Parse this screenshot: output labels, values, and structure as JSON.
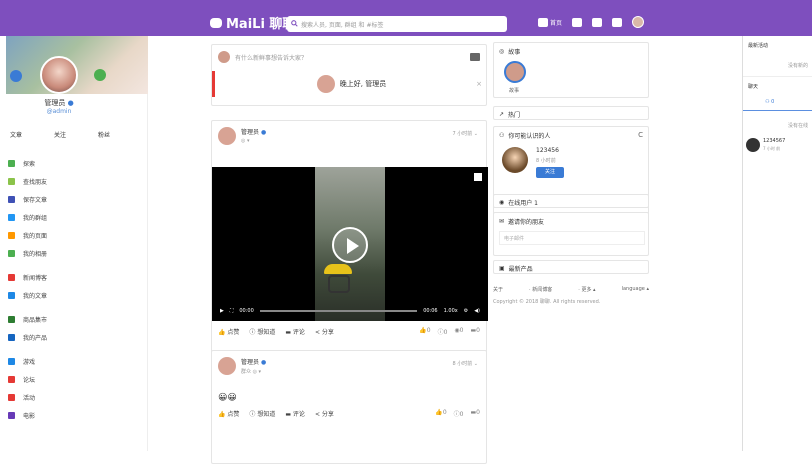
{
  "topbar": {
    "brand": "MaiLi 聊聊",
    "search_placeholder": "搜索人员, 页面, 群组 和 #标签",
    "home_label": "首页"
  },
  "profile": {
    "name": "管理员",
    "handle": "@admin",
    "stats": [
      "文章",
      "关注",
      "粉丝"
    ]
  },
  "menu": [
    {
      "label": "探索",
      "color": "#4caf50"
    },
    {
      "label": "查找朋友",
      "color": "#8bc34a"
    },
    {
      "label": "保存文章",
      "color": "#3f51b5"
    },
    {
      "label": "我的群组",
      "color": "#2196f3"
    },
    {
      "label": "我的页面",
      "color": "#ff9800"
    },
    {
      "label": "我的相册",
      "color": "#4caf50"
    },
    {
      "label": "新闻博客",
      "color": "#e53935"
    },
    {
      "label": "我的文章",
      "color": "#1e88e5"
    },
    {
      "label": "商品集市",
      "color": "#2e7d32"
    },
    {
      "label": "我的产品",
      "color": "#1565c0"
    },
    {
      "label": "游戏",
      "color": "#1e88e5"
    },
    {
      "label": "论坛",
      "color": "#e53935"
    },
    {
      "label": "活动",
      "color": "#e53935"
    },
    {
      "label": "电影",
      "color": "#673ab7"
    }
  ],
  "composer": {
    "placeholder": "有什么新鲜事想告诉大家？",
    "greeting": "晚上好, 管理员"
  },
  "post1": {
    "author": "管理员",
    "time": "7 小时前",
    "video_time_start": "00:00",
    "video_time_end": "00:06",
    "speed": "1.00x",
    "like": "点赞",
    "wonder": "想知道",
    "comment": "评论",
    "share": "分享",
    "counts": [
      "0",
      "0",
      "0",
      "0"
    ]
  },
  "post2": {
    "author": "管理员",
    "sub": "群众",
    "time": "8 小时前",
    "emojis": "😀😀",
    "like": "点赞",
    "wonder": "想知道",
    "comment": "评论",
    "share": "分享",
    "counts": [
      "0",
      "0",
      "0"
    ]
  },
  "widgets": {
    "story_title": "故事",
    "story_label": "故事",
    "hot_title": "热门",
    "know_title": "你可能认识的人",
    "know_name": "123456",
    "know_time": "8 小时前",
    "follow": "关注",
    "online_title": "在线用户 1",
    "invite_title": "邀请你的朋友",
    "invite_placeholder": "电子邮件",
    "latest_title": "最新产品",
    "links": [
      "关于",
      "· 新闻博客",
      "· 更多 ▴",
      "language ▴"
    ],
    "copyright": "Copyright © 2018 聊聊. All rights reserved."
  },
  "rightbar": {
    "activity_title": "最新活动",
    "no_activity": "没有新的",
    "chat_title": "聊天",
    "online_count": "0",
    "no_online": "没有在线",
    "user": "1234567",
    "user_time": "7 小时 前"
  }
}
